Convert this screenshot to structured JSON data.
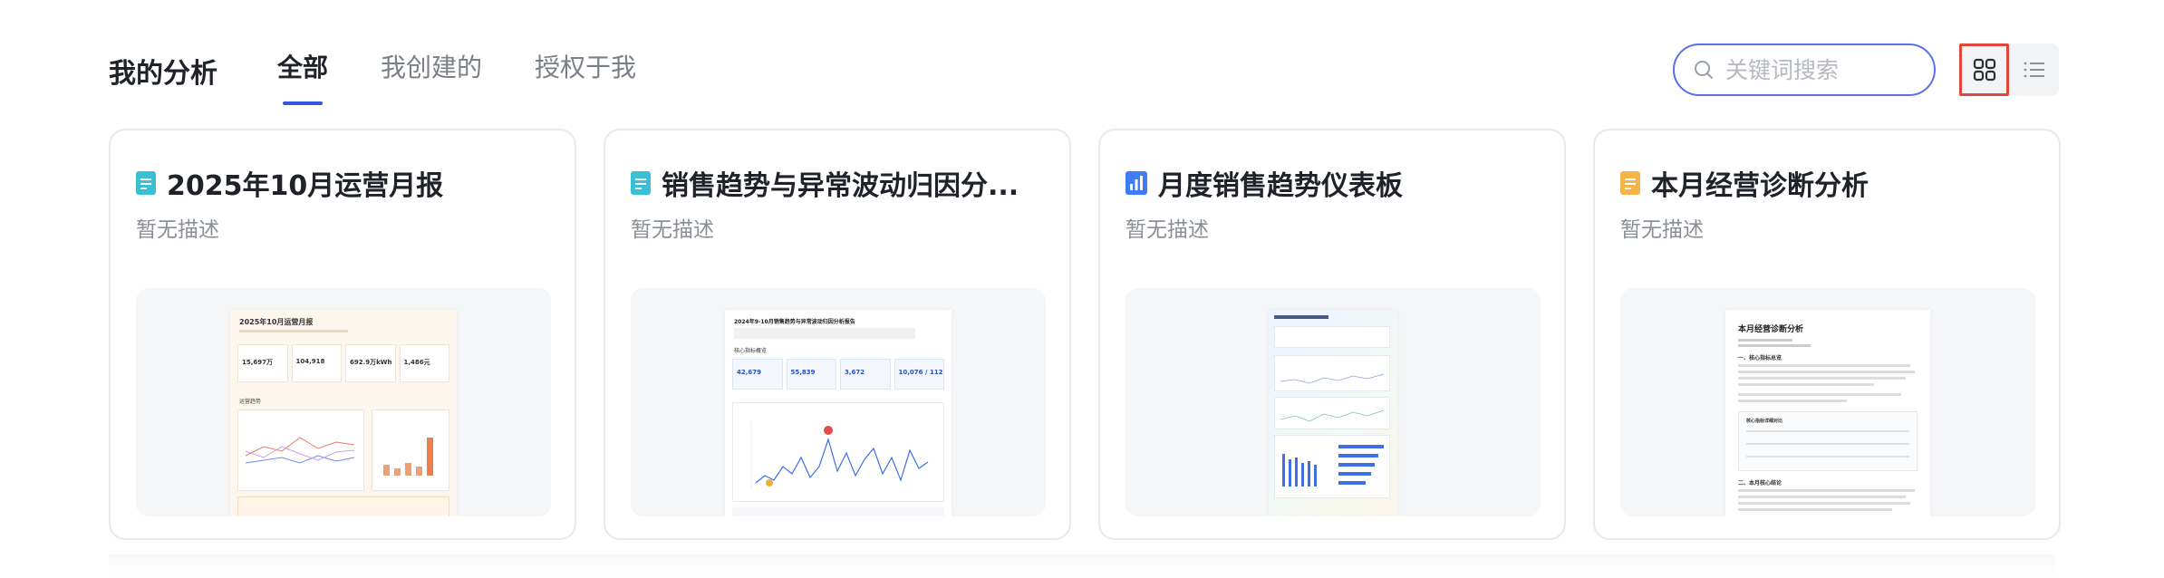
{
  "header": {
    "title": "我的分析",
    "tabs": [
      {
        "label": "全部",
        "active": true
      },
      {
        "label": "我创建的",
        "active": false
      },
      {
        "label": "授权于我",
        "active": false
      }
    ],
    "search_placeholder": "关键词搜索",
    "view_modes": [
      "grid-view-icon",
      "list-view-icon"
    ],
    "active_view": "grid"
  },
  "cards": [
    {
      "title": "2025年10月运营月报",
      "description": "暂无描述",
      "icon": "document-icon",
      "icon_color": "#3bbfd4",
      "preview": {
        "heading": "2025年10月运营月报",
        "stats": [
          "15,697万",
          "104,918",
          "692.9万kWh",
          "1,486元"
        ],
        "section": "运营趋势"
      }
    },
    {
      "title": "销售趋势与异常波动归因分...",
      "description": "暂无描述",
      "icon": "document-icon",
      "icon_color": "#3bbfd4",
      "preview": {
        "heading": "2024年9-10月销售趋势与异常波动归因分析报告",
        "stats": [
          "42,679",
          "55,839",
          "3,672",
          "10,076 / 112"
        ],
        "section": "核心指标概览"
      }
    },
    {
      "title": "月度销售趋势仪表板",
      "description": "暂无描述",
      "icon": "bar-chart-icon",
      "icon_color": "#3f7df5"
    },
    {
      "title": "本月经营诊断分析",
      "description": "暂无描述",
      "icon": "document-icon",
      "icon_color": "#f5b34a",
      "preview": {
        "heading": "本月经营诊断分析",
        "section": "一、核心指标总览",
        "section2": "二、本月核心结论",
        "table_title": "核心指标详细对比"
      }
    }
  ],
  "colors": {
    "accent": "#3456e0",
    "highlight_border": "#e0463a",
    "search_border": "#5b6fe6"
  }
}
